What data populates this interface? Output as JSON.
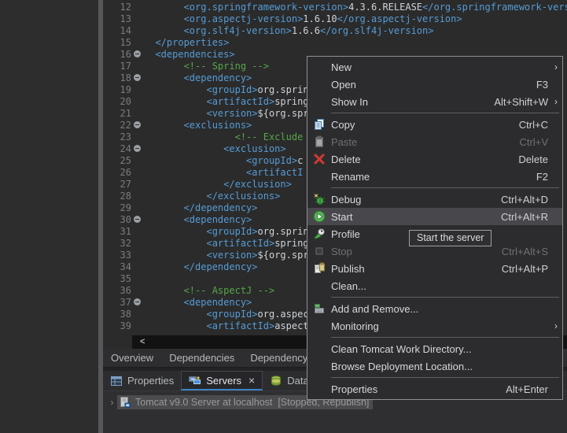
{
  "colors": {
    "accent_blue": "#3f83c9",
    "tag_blue": "#569cd6",
    "comment_green": "#57a64a",
    "menu_highlight": "#48484c",
    "selection_gray": "#4b4b4d",
    "menu_border": "#8f9094"
  },
  "editor": {
    "hscroll_arrow": "<",
    "lines": [
      {
        "num": "12",
        "fold": false,
        "segments": [
          [
            "text",
            "       "
          ],
          [
            "tag",
            "<org.springframework-version>"
          ],
          [
            "text",
            "4.3.6.RELEASE"
          ],
          [
            "tag",
            "</org.springframework-version"
          ]
        ]
      },
      {
        "num": "13",
        "fold": false,
        "segments": [
          [
            "text",
            "       "
          ],
          [
            "tag",
            "<org.aspectj-version>"
          ],
          [
            "text",
            "1.6.10"
          ],
          [
            "tag",
            "</org.aspectj-version>"
          ]
        ]
      },
      {
        "num": "14",
        "fold": false,
        "segments": [
          [
            "text",
            "       "
          ],
          [
            "tag",
            "<org.slf4j-version>"
          ],
          [
            "text",
            "1.6.6"
          ],
          [
            "tag",
            "</org.slf4j-version>"
          ]
        ]
      },
      {
        "num": "15",
        "fold": false,
        "segments": [
          [
            "text",
            "  "
          ],
          [
            "tag",
            "</properties>"
          ]
        ]
      },
      {
        "num": "16",
        "fold": true,
        "segments": [
          [
            "text",
            "  "
          ],
          [
            "tag",
            "<dependencies>"
          ]
        ]
      },
      {
        "num": "17",
        "fold": false,
        "segments": [
          [
            "text",
            "       "
          ],
          [
            "comment",
            "<!-- Spring -->"
          ]
        ]
      },
      {
        "num": "18",
        "fold": true,
        "segments": [
          [
            "text",
            "       "
          ],
          [
            "tag",
            "<dependency>"
          ]
        ]
      },
      {
        "num": "19",
        "fold": false,
        "segments": [
          [
            "text",
            "           "
          ],
          [
            "tag",
            "<groupId>"
          ],
          [
            "text",
            "org.spring"
          ]
        ]
      },
      {
        "num": "20",
        "fold": false,
        "segments": [
          [
            "text",
            "           "
          ],
          [
            "tag",
            "<artifactId>"
          ],
          [
            "text",
            "spring"
          ]
        ]
      },
      {
        "num": "21",
        "fold": false,
        "segments": [
          [
            "text",
            "           "
          ],
          [
            "tag",
            "<version>"
          ],
          [
            "text",
            "${org.spr"
          ]
        ]
      },
      {
        "num": "22",
        "fold": true,
        "segments": [
          [
            "text",
            "       "
          ],
          [
            "tag",
            "<exclusions>"
          ]
        ]
      },
      {
        "num": "23",
        "fold": false,
        "segments": [
          [
            "text",
            "                "
          ],
          [
            "comment",
            "<!-- Exclude C"
          ]
        ]
      },
      {
        "num": "24",
        "fold": true,
        "segments": [
          [
            "text",
            "              "
          ],
          [
            "tag",
            "<exclusion>"
          ]
        ]
      },
      {
        "num": "25",
        "fold": false,
        "segments": [
          [
            "text",
            "                  "
          ],
          [
            "tag",
            "<groupId>"
          ],
          [
            "text",
            "c"
          ]
        ]
      },
      {
        "num": "26",
        "fold": false,
        "segments": [
          [
            "text",
            "                  "
          ],
          [
            "tag",
            "<artifactI"
          ]
        ]
      },
      {
        "num": "27",
        "fold": false,
        "segments": [
          [
            "text",
            "              "
          ],
          [
            "tag",
            "</exclusion>"
          ]
        ]
      },
      {
        "num": "28",
        "fold": false,
        "segments": [
          [
            "text",
            "           "
          ],
          [
            "tag",
            "</exclusions>"
          ]
        ]
      },
      {
        "num": "29",
        "fold": false,
        "segments": [
          [
            "text",
            "       "
          ],
          [
            "tag",
            "</dependency>"
          ]
        ]
      },
      {
        "num": "30",
        "fold": true,
        "segments": [
          [
            "text",
            "       "
          ],
          [
            "tag",
            "<dependency>"
          ]
        ]
      },
      {
        "num": "31",
        "fold": false,
        "segments": [
          [
            "text",
            "           "
          ],
          [
            "tag",
            "<groupId>"
          ],
          [
            "text",
            "org.sprin"
          ]
        ]
      },
      {
        "num": "32",
        "fold": false,
        "segments": [
          [
            "text",
            "           "
          ],
          [
            "tag",
            "<artifactId>"
          ],
          [
            "text",
            "spring"
          ]
        ]
      },
      {
        "num": "33",
        "fold": false,
        "segments": [
          [
            "text",
            "           "
          ],
          [
            "tag",
            "<version>"
          ],
          [
            "text",
            "${org.spr"
          ]
        ]
      },
      {
        "num": "34",
        "fold": false,
        "segments": [
          [
            "text",
            "       "
          ],
          [
            "tag",
            "</dependency>"
          ]
        ]
      },
      {
        "num": "35",
        "fold": false,
        "segments": []
      },
      {
        "num": "36",
        "fold": false,
        "segments": [
          [
            "text",
            "       "
          ],
          [
            "comment",
            "<!-- AspectJ -->"
          ]
        ]
      },
      {
        "num": "37",
        "fold": true,
        "segments": [
          [
            "text",
            "       "
          ],
          [
            "tag",
            "<dependency>"
          ]
        ]
      },
      {
        "num": "38",
        "fold": false,
        "segments": [
          [
            "text",
            "           "
          ],
          [
            "tag",
            "<groupId>"
          ],
          [
            "text",
            "org.aspec"
          ]
        ]
      },
      {
        "num": "39",
        "fold": false,
        "segments": [
          [
            "text",
            "           "
          ],
          [
            "tag",
            "<artifactId>"
          ],
          [
            "text",
            "aspect"
          ]
        ]
      }
    ]
  },
  "editor_tabs": {
    "overview": "Overview",
    "dependencies": "Dependencies",
    "dependency_hierarchy": "Dependency Hierarchy"
  },
  "bottom_tabs": {
    "properties": "Properties",
    "servers": "Servers",
    "servers_close": "×",
    "data_source": "Data Source"
  },
  "servers_view": {
    "expander": "›",
    "row_text": "Tomcat v9.0 Server at localhost  [Stopped, Republish]"
  },
  "menu": {
    "items": [
      {
        "label": "New",
        "submenu": true
      },
      {
        "label": "Open",
        "shortcut": "F3"
      },
      {
        "label": "Show In",
        "shortcut": "Alt+Shift+W",
        "submenu": true
      },
      {
        "separator": true
      },
      {
        "label": "Copy",
        "shortcut": "Ctrl+C",
        "icon": "copy-icon"
      },
      {
        "label": "Paste",
        "shortcut": "Ctrl+V",
        "icon": "paste-icon",
        "disabled": true
      },
      {
        "label": "Delete",
        "shortcut": "Delete",
        "icon": "delete-icon"
      },
      {
        "label": "Rename",
        "shortcut": "F2"
      },
      {
        "separator": true
      },
      {
        "label": "Debug",
        "shortcut": "Ctrl+Alt+D",
        "icon": "debug-icon"
      },
      {
        "label": "Start",
        "shortcut": "Ctrl+Alt+R",
        "icon": "start-icon",
        "highlighted": true
      },
      {
        "label": "Profile",
        "icon": "profile-icon"
      },
      {
        "label": "Stop",
        "shortcut": "Ctrl+Alt+S",
        "icon": "stop-icon",
        "disabled": true
      },
      {
        "label": "Publish",
        "shortcut": "Ctrl+Alt+P",
        "icon": "publish-icon"
      },
      {
        "label": "Clean..."
      },
      {
        "separator": true
      },
      {
        "label": "Add and Remove...",
        "icon": "add-remove-icon"
      },
      {
        "label": "Monitoring",
        "submenu": true
      },
      {
        "separator": true
      },
      {
        "label": "Clean Tomcat Work Directory..."
      },
      {
        "label": "Browse Deployment Location..."
      },
      {
        "separator": true
      },
      {
        "label": "Properties",
        "shortcut": "Alt+Enter"
      }
    ],
    "submenu_arrow": "›"
  },
  "tooltip": {
    "text": "Start the server"
  }
}
